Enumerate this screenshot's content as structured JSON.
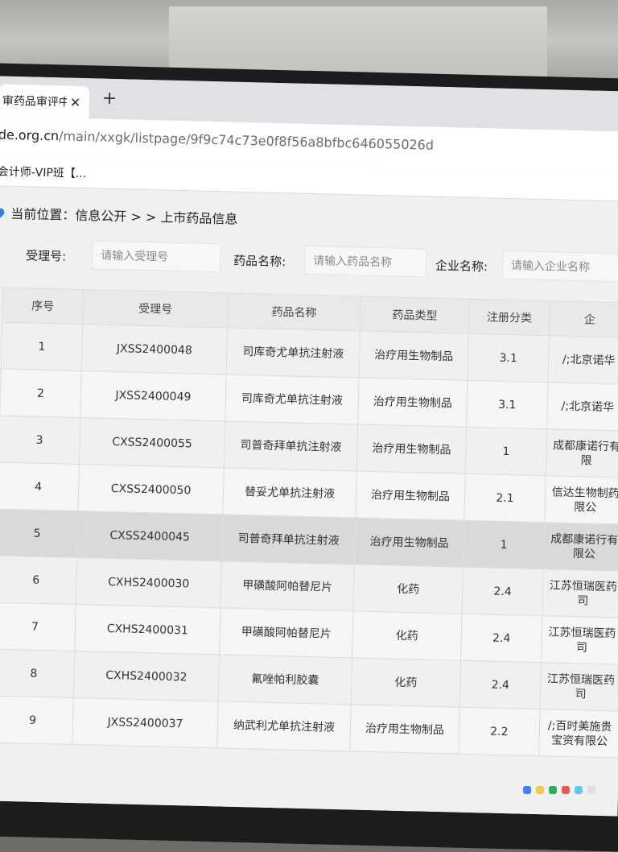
{
  "browser": {
    "tab_title": "审药品审评中",
    "close_icon": "✕",
    "new_tab_icon": "+",
    "url_host": "de.org.cn",
    "url_path": "/main/xxgk/listpage/9f9c74c73e0f8f56a8bfbc646055026d",
    "bookmark": "会计师-VIP班【..."
  },
  "breadcrumb": {
    "text": "当前位置：信息公开 > > 上市药品信息"
  },
  "search": {
    "acceptance_label": "受理号:",
    "acceptance_placeholder": "请输入受理号",
    "drug_label": "药品名称:",
    "drug_placeholder": "请输入药品名称",
    "company_label": "企业名称:",
    "company_placeholder": "请输入企业名称"
  },
  "table": {
    "headers": [
      "序号",
      "受理号",
      "药品名称",
      "药品类型",
      "注册分类",
      "企"
    ],
    "rows": [
      [
        "1",
        "JXSS2400048",
        "司库奇尤单抗注射液",
        "治疗用生物制品",
        "3.1",
        "/;北京诺华"
      ],
      [
        "2",
        "JXSS2400049",
        "司库奇尤单抗注射液",
        "治疗用生物制品",
        "3.1",
        "/;北京诺华"
      ],
      [
        "3",
        "CXSS2400055",
        "司普奇拜单抗注射液",
        "治疗用生物制品",
        "1",
        "成都康诺行有限"
      ],
      [
        "4",
        "CXSS2400050",
        "替妥尤单抗注射液",
        "治疗用生物制品",
        "2.1",
        "信达生物制药限公"
      ],
      [
        "5",
        "CXSS2400045",
        "司普奇拜单抗注射液",
        "治疗用生物制品",
        "1",
        "成都康诺行有限公"
      ],
      [
        "6",
        "CXHS2400030",
        "甲磺酸阿帕替尼片",
        "化药",
        "2.4",
        "江苏恒瑞医药司"
      ],
      [
        "7",
        "CXHS2400031",
        "甲磺酸阿帕替尼片",
        "化药",
        "2.4",
        "江苏恒瑞医药司"
      ],
      [
        "8",
        "CXHS2400032",
        "氟唑帕利胶囊",
        "化药",
        "2.4",
        "江苏恒瑞医药司"
      ],
      [
        "9",
        "JXSS2400037",
        "纳武利尤单抗注射液",
        "治疗用生物制品",
        "2.2",
        "/;百时美施贵宝资有限公"
      ]
    ]
  },
  "colors": {
    "accent": "#2f80ed",
    "table_header_bg": "#e9e9e8",
    "highlight_row_bg": "#d9d9d8"
  }
}
